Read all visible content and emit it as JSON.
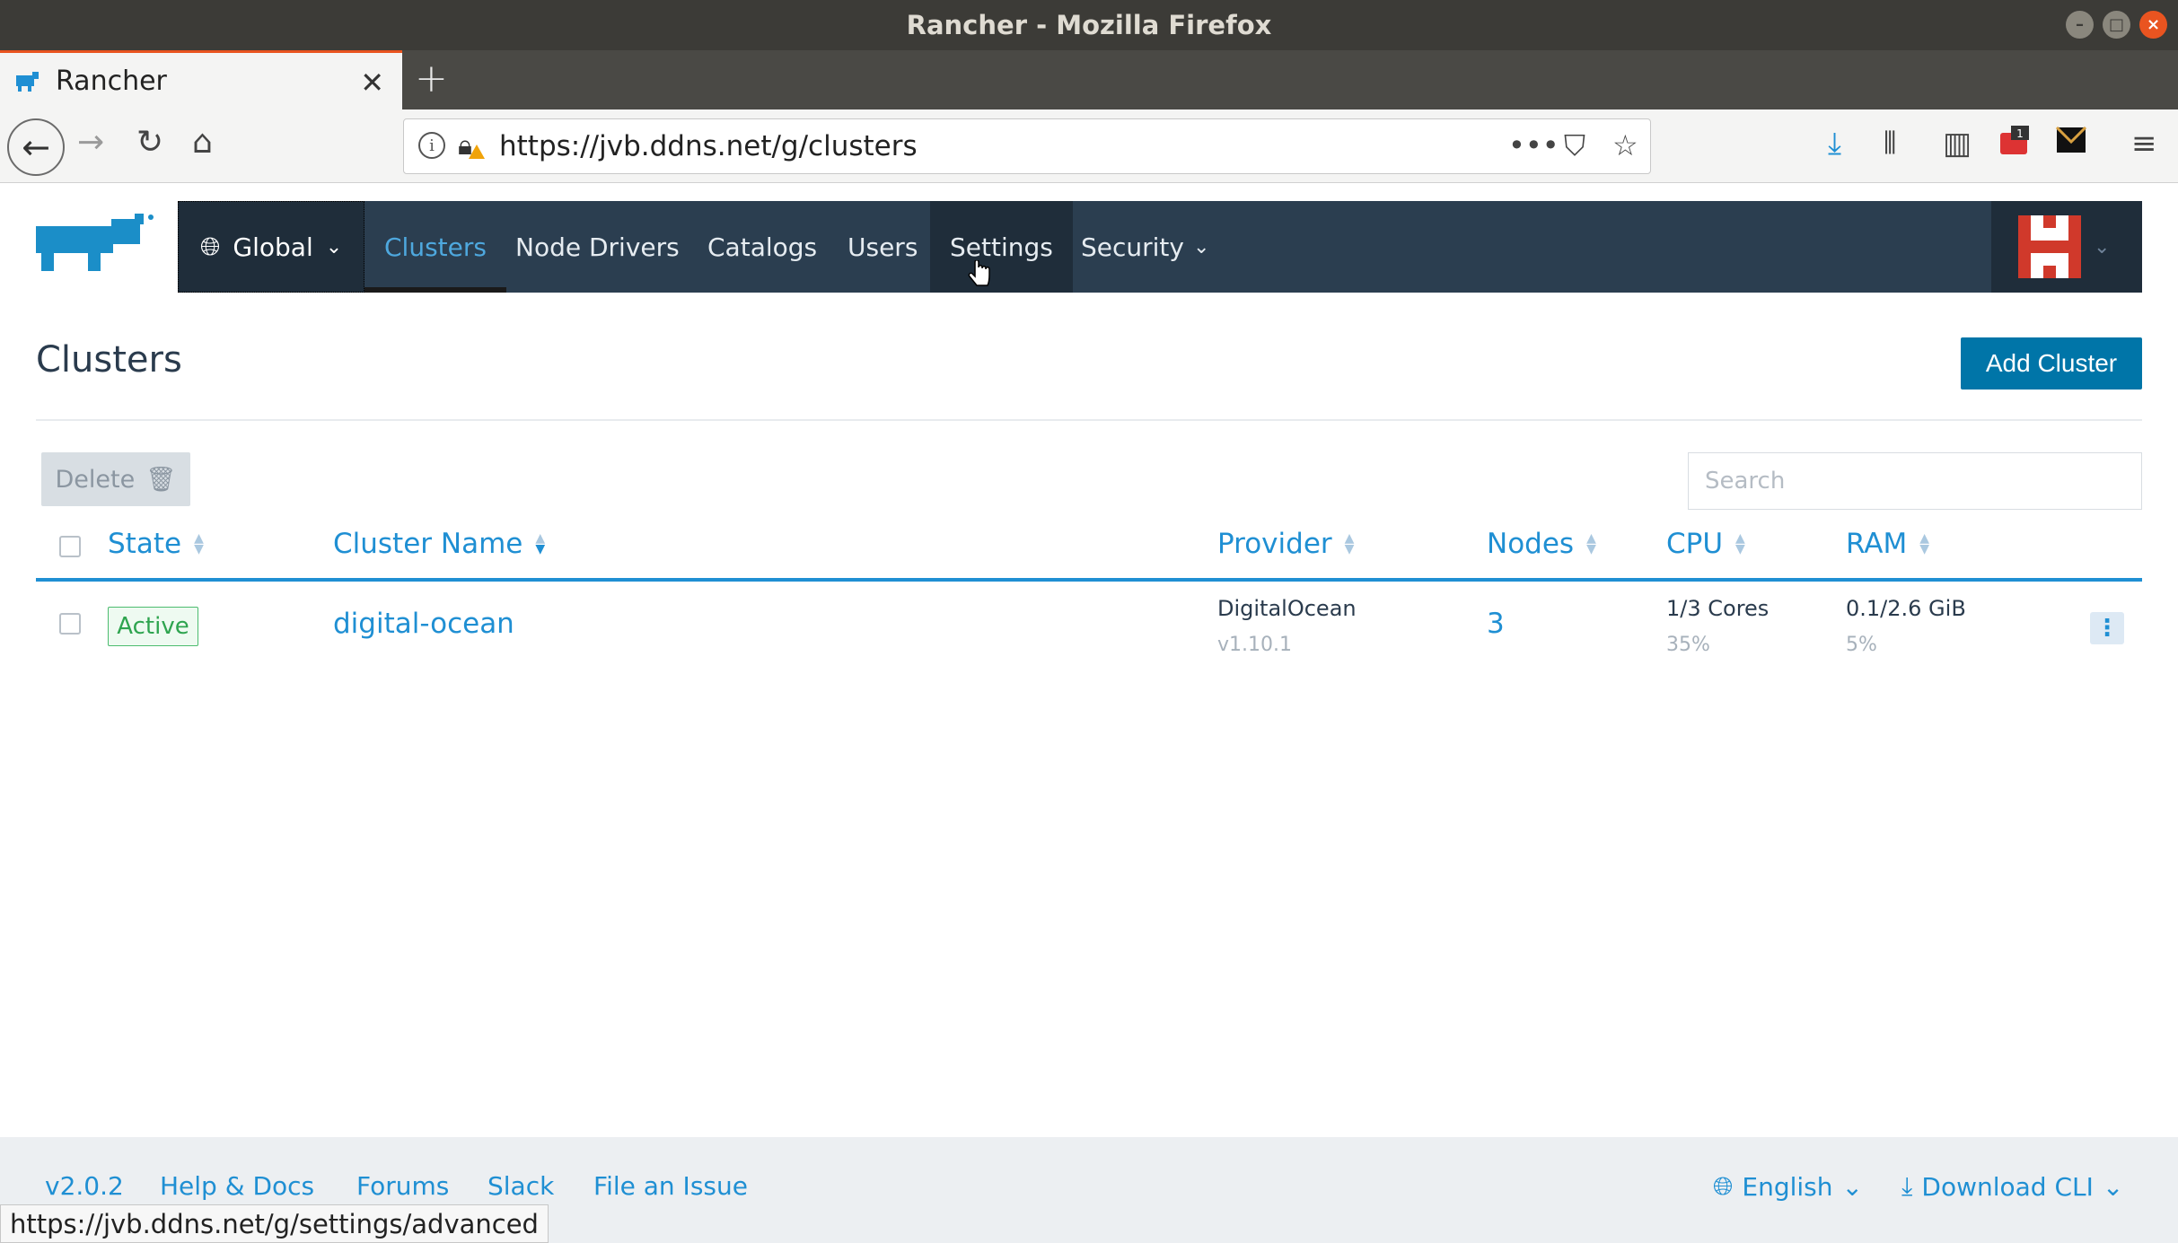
{
  "window": {
    "title": "Rancher - Mozilla Firefox"
  },
  "tab": {
    "title": "Rancher"
  },
  "urlbar": {
    "url": "https://jvb.ddns.net/g/clusters"
  },
  "toolbar": {
    "library_badge": "1"
  },
  "appnav": {
    "scope": "Global",
    "items": [
      "Clusters",
      "Node Drivers",
      "Catalogs",
      "Users",
      "Settings",
      "Security"
    ]
  },
  "page": {
    "title": "Clusters",
    "add_button": "Add Cluster"
  },
  "bulk": {
    "delete_label": "Delete"
  },
  "search": {
    "placeholder": "Search"
  },
  "table": {
    "headers": [
      "State",
      "Cluster Name",
      "Provider",
      "Nodes",
      "CPU",
      "RAM"
    ],
    "rows": [
      {
        "state": "Active",
        "name": "digital-ocean",
        "provider": "DigitalOcean",
        "version": "v1.10.1",
        "nodes": "3",
        "cpu": "1/3 Cores",
        "cpu_pct": "35%",
        "ram": "0.1/2.6 GiB",
        "ram_pct": "5%"
      }
    ]
  },
  "footer": {
    "version": "v2.0.2",
    "help": "Help & Docs",
    "forums": "Forums",
    "slack": "Slack",
    "issue": "File an Issue",
    "language": "English",
    "download": "Download CLI"
  },
  "status_url": "https://jvb.ddns.net/g/settings/advanced",
  "colors": {
    "accent": "#1f8fd3",
    "nav_bg": "#2b3e50",
    "primary_button": "#0075a8",
    "active_badge": "#2ea44f"
  }
}
